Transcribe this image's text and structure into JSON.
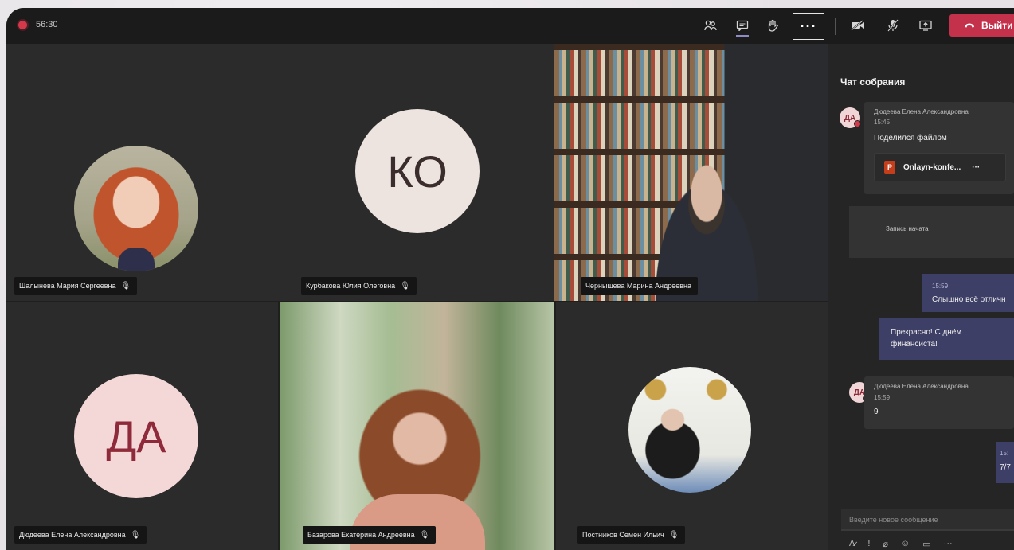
{
  "meeting": {
    "timer": "56:30"
  },
  "toolbar": {
    "participants_icon": "people-icon",
    "chat_icon": "chat-icon",
    "raise_hand_icon": "hand-icon",
    "more_label": "···",
    "camera_icon": "camera-off-icon",
    "mic_icon": "mic-off-icon",
    "share_icon": "share-screen-icon",
    "leave_label": "Выйти",
    "leave_color": "#c4314b"
  },
  "participants": [
    {
      "name": "Шалынева Мария Сергеевна",
      "type": "photo"
    },
    {
      "name": "Курбакова Юлия Олеговна",
      "type": "initials",
      "initials": "КО"
    },
    {
      "name": "Чернышева Марина Андреевна",
      "type": "video"
    },
    {
      "name": "Дюдеева Елена Александровна",
      "type": "initials",
      "initials": "ДА"
    },
    {
      "name": "Базарова Екатерина Андреевна",
      "type": "video"
    },
    {
      "name": "Постников Семен Ильич",
      "type": "photo"
    }
  ],
  "chat": {
    "title": "Чат собрания",
    "messages": [
      {
        "avatar": "ДА",
        "sender": "Дюдеева Елена Александровна",
        "time": "15:45",
        "text": "Поделился файлом",
        "file": "Onlayn-konfe...",
        "file_more": "···"
      },
      {
        "system": "Запись начата"
      },
      {
        "own": true,
        "time": "15:59",
        "text": "Слышно всё отличн"
      },
      {
        "own": true,
        "text": "Прекрасно! С днём финансиста!"
      },
      {
        "avatar": "ДА",
        "sender": "Дюдеева Елена Александровна",
        "time": "15:59",
        "text": "9"
      },
      {
        "own": true,
        "time": "15:",
        "text": "7/7"
      }
    ],
    "input_placeholder": "Введите новое сообщение",
    "format_icons": [
      "format-icon",
      "important-icon",
      "attach-icon",
      "emoji-icon",
      "gif-icon",
      "more-icon"
    ]
  },
  "colors": {
    "accent": "#8b8cc7",
    "recording": "#d4394b",
    "own_message": "#3e3f66"
  }
}
